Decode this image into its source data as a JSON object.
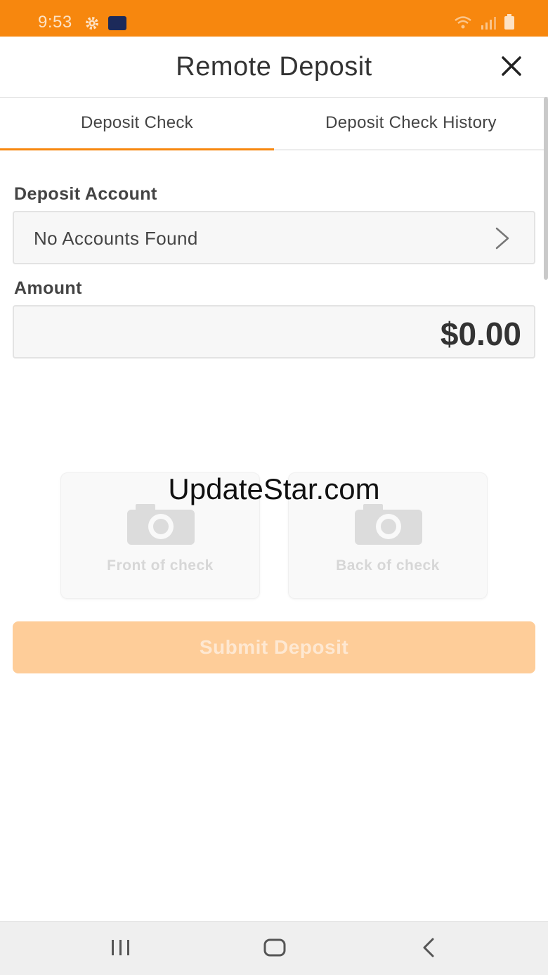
{
  "status_bar": {
    "time": "9:53",
    "icons": [
      "gear-icon",
      "app-notification-icon",
      "wifi-icon",
      "signal-icon",
      "battery-icon"
    ],
    "background": "#f7870e"
  },
  "header": {
    "title": "Remote Deposit",
    "close_icon": "close-icon"
  },
  "tabs": [
    {
      "label": "Deposit Check",
      "active": true
    },
    {
      "label": "Deposit Check History",
      "active": false
    }
  ],
  "form": {
    "account_label": "Deposit Account",
    "account_value": "No Accounts Found",
    "amount_label": "Amount",
    "amount_value": "$0.00"
  },
  "check_images": {
    "front_label": "Front of check",
    "back_label": "Back of check",
    "icon": "camera-icon"
  },
  "watermark": "UpdateStar.com",
  "submit": {
    "label": "Submit Deposit",
    "enabled": false
  },
  "nav_bar": {
    "icons": [
      "recent-apps-icon",
      "home-icon",
      "back-icon"
    ]
  },
  "colors": {
    "accent": "#f7870e",
    "submit_disabled": "#fecd99"
  }
}
